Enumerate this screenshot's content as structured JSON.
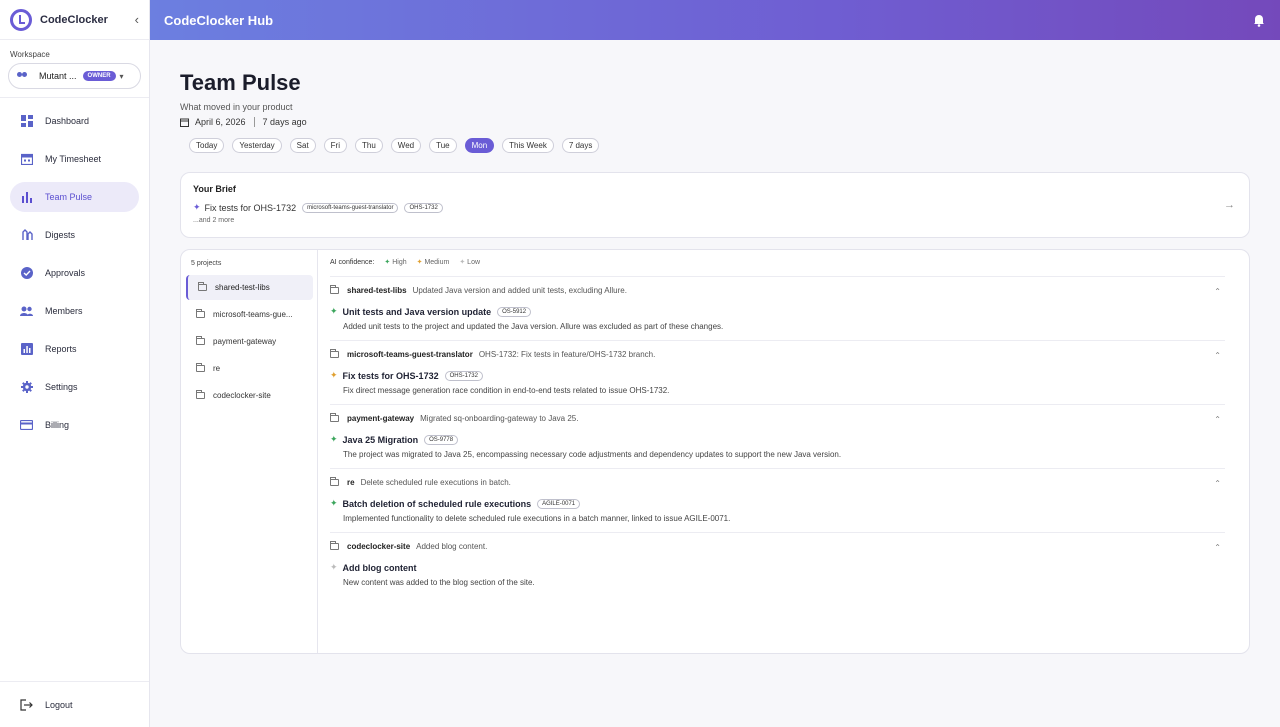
{
  "brand": {
    "name": "CodeClocker",
    "collapse_icon": "chevron-left-icon"
  },
  "workspace": {
    "label": "Workspace",
    "name": "Mutant ...",
    "badge": "OWNER"
  },
  "nav": [
    {
      "label": "Dashboard",
      "icon": "grid-icon",
      "active": false
    },
    {
      "label": "My Timesheet",
      "icon": "calendar-icon",
      "active": false
    },
    {
      "label": "Team Pulse",
      "icon": "bar-chart-icon",
      "active": true
    },
    {
      "label": "Digests",
      "icon": "digest-icon",
      "active": false
    },
    {
      "label": "Approvals",
      "icon": "check-circle-icon",
      "active": false
    },
    {
      "label": "Members",
      "icon": "people-icon",
      "active": false
    },
    {
      "label": "Reports",
      "icon": "report-icon",
      "active": false
    },
    {
      "label": "Settings",
      "icon": "gear-icon",
      "active": false
    },
    {
      "label": "Billing",
      "icon": "card-icon",
      "active": false
    }
  ],
  "logout": {
    "label": "Logout"
  },
  "header": {
    "title": "CodeClocker Hub"
  },
  "page": {
    "title": "Team Pulse",
    "subtitle": "What moved in your product",
    "date": "April 6, 2026",
    "relative": "7 days ago",
    "chips": [
      "Today",
      "Yesterday",
      "Sat",
      "Fri",
      "Thu",
      "Wed",
      "Tue",
      "Mon",
      "This Week",
      "7 days"
    ],
    "active_chip": "Mon"
  },
  "brief": {
    "title": "Your Brief",
    "item": "Fix tests for OHS-1732",
    "tags": [
      "microsoft-teams-guest-translator",
      "OHS-1732"
    ],
    "more": "...and 2 more"
  },
  "projects": {
    "count": "5 projects",
    "items": [
      "shared-test-libs",
      "microsoft-teams-gue...",
      "payment-gateway",
      "re",
      "codeclocker-site"
    ]
  },
  "confidence": {
    "label": "AI confidence:",
    "high": "High",
    "medium": "Medium",
    "low": "Low"
  },
  "colors": {
    "accent": "#6a5cd6",
    "high": "#3ba55c",
    "medium": "#e0a030",
    "low": "#bbbbbb"
  },
  "blocks": [
    {
      "name": "shared-test-libs",
      "summary": "Updated Java version and added unit tests, excluding Allure.",
      "item": "Unit tests and Java version update",
      "tag": "OS-5912",
      "desc": "Added unit tests to the project and updated the Java version. Allure was excluded as part of these changes."
    },
    {
      "name": "microsoft-teams-guest-translator",
      "summary": "OHS-1732: Fix tests in feature/OHS-1732 branch.",
      "item": "Fix tests for OHS-1732",
      "tag": "OHS-1732",
      "desc": "Fix direct message generation race condition in end-to-end tests related to issue OHS-1732."
    },
    {
      "name": "payment-gateway",
      "summary": "Migrated sq-onboarding-gateway to Java 25.",
      "item": "Java 25 Migration",
      "tag": "OS-9778",
      "desc": "The project was migrated to Java 25, encompassing necessary code adjustments and dependency updates to support the new Java version."
    },
    {
      "name": "re",
      "summary": "Delete scheduled rule executions in batch.",
      "item": "Batch deletion of scheduled rule executions",
      "tag": "AGILE-0071",
      "desc": "Implemented functionality to delete scheduled rule executions in a batch manner, linked to issue AGILE-0071."
    },
    {
      "name": "codeclocker-site",
      "summary": "Added blog content.",
      "item": "Add blog content",
      "tag": "",
      "desc": "New content was added to the blog section of the site."
    }
  ]
}
